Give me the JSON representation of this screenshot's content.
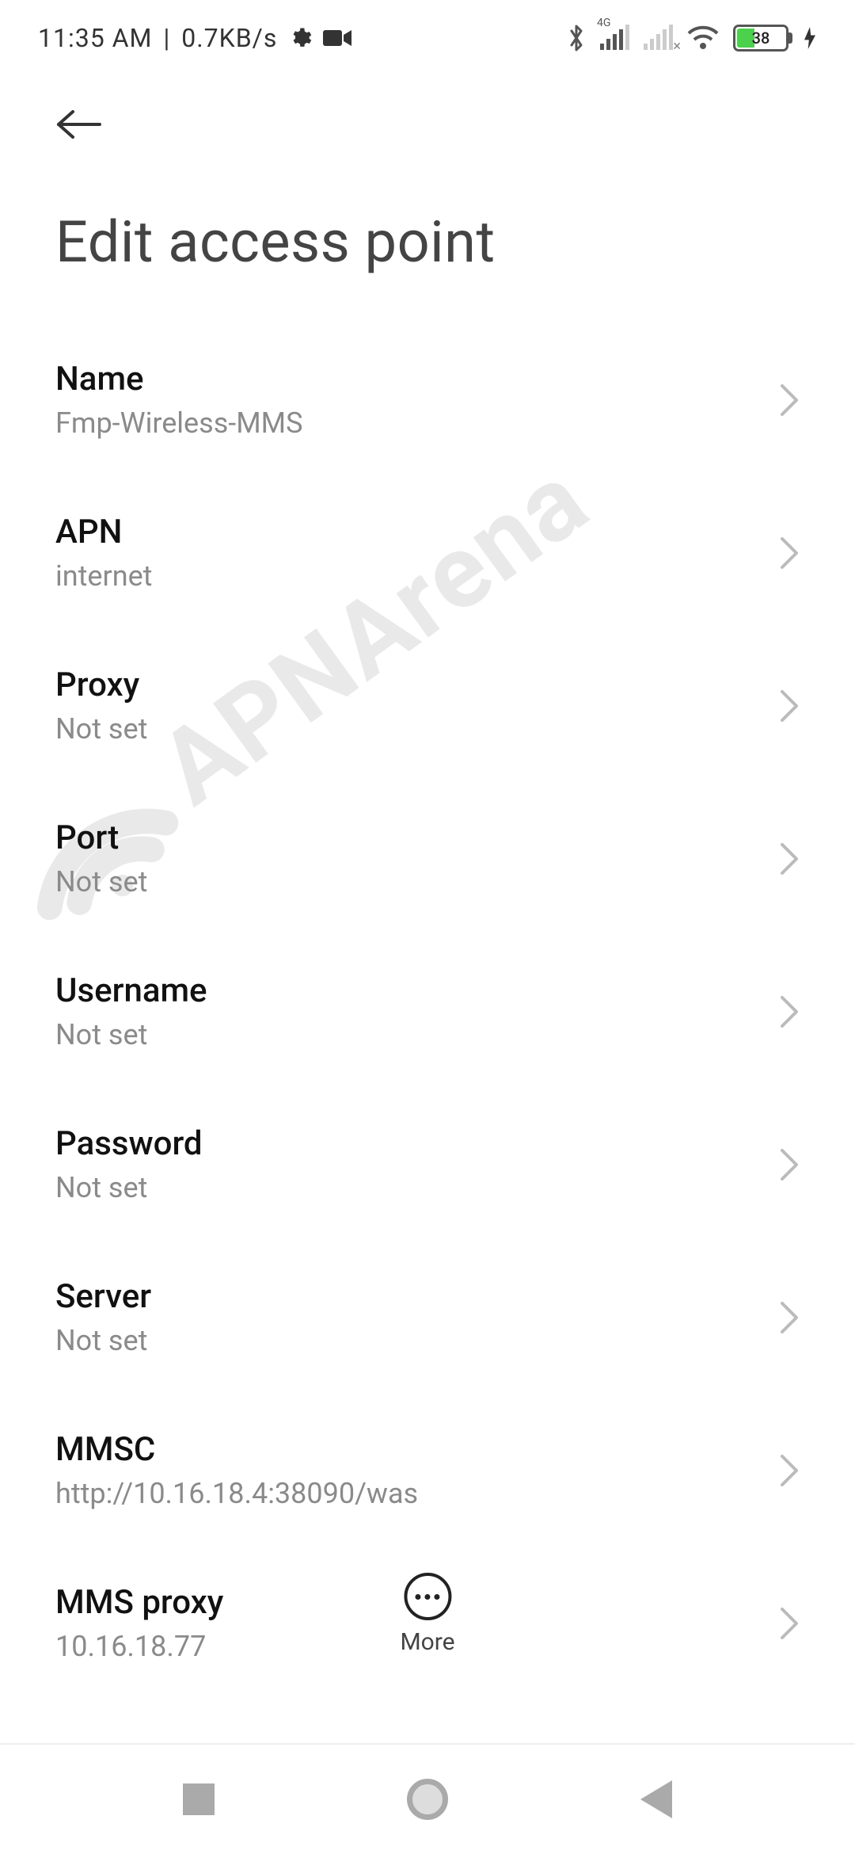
{
  "status": {
    "time": "11:35 AM",
    "net_speed": "0.7KB/s",
    "battery_pct": "38",
    "network_badge": "4G"
  },
  "page": {
    "title": "Edit access point"
  },
  "settings": [
    {
      "label": "Name",
      "value": "Fmp-Wireless-MMS"
    },
    {
      "label": "APN",
      "value": "internet"
    },
    {
      "label": "Proxy",
      "value": "Not set"
    },
    {
      "label": "Port",
      "value": "Not set"
    },
    {
      "label": "Username",
      "value": "Not set"
    },
    {
      "label": "Password",
      "value": "Not set"
    },
    {
      "label": "Server",
      "value": "Not set"
    },
    {
      "label": "MMSC",
      "value": "http://10.16.18.4:38090/was"
    },
    {
      "label": "MMS proxy",
      "value": "10.16.18.77"
    }
  ],
  "fab": {
    "label": "More"
  },
  "watermark": {
    "text": "APNArena"
  }
}
